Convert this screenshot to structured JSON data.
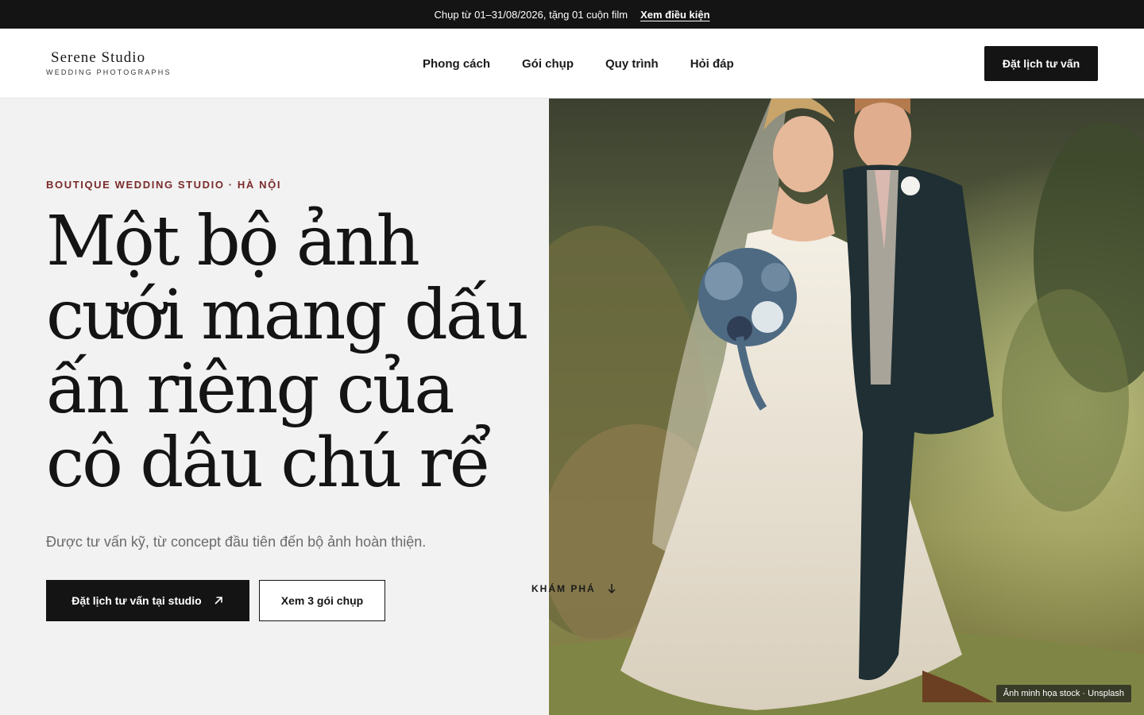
{
  "promo": {
    "text": "Chụp từ 01–31/08/2026, tặng 01 cuộn film",
    "link": "Xem điều kiện"
  },
  "brand": {
    "name": "Serene Studio",
    "tagline": "WEDDING PHOTOGRAPHS"
  },
  "nav": {
    "items": [
      "Phong cách",
      "Gói chụp",
      "Quy trình",
      "Hỏi đáp"
    ]
  },
  "header_cta": "Đặt lịch tư vấn",
  "hero": {
    "eyebrow": "BOUTIQUE WEDDING STUDIO · HÀ NỘI",
    "headline_lines": [
      "Một bộ ảnh",
      "cưới mang dấu",
      "ấn riêng của",
      "cô dâu chú rể"
    ],
    "subtitle": "Được tư vấn kỹ, từ concept đầu tiên đến bộ ảnh hoàn thiện.",
    "primary_cta": "Đặt lịch tư vấn tại studio",
    "secondary_cta": "Xem 3 gói chụp",
    "explore": "KHÁM PHÁ",
    "image_credit": "Ảnh minh họa stock · Unsplash"
  },
  "icons": {
    "primary_cta_icon": "arrow-up-right-icon",
    "explore_icon": "arrow-down-icon"
  },
  "colors": {
    "ink": "#141414",
    "accent": "#7a2a2a",
    "background": "#f2f2f2"
  }
}
